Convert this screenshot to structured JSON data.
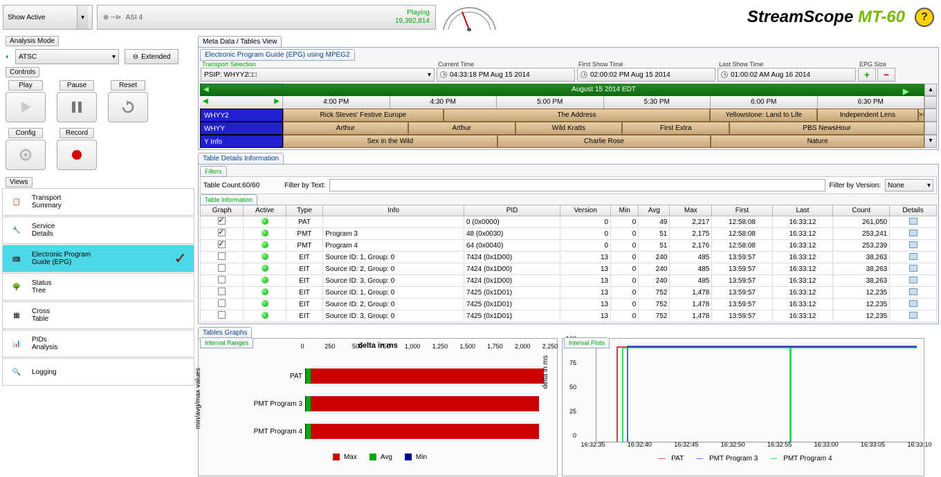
{
  "topbar": {
    "show_active": "Show Active",
    "stream_name": "ASI 4",
    "status": "Playing",
    "packets": "19,392,814"
  },
  "brand": {
    "name": "StreamScope",
    "model": " MT-60",
    "help": "?"
  },
  "analysis_mode": {
    "label": "Analysis Mode",
    "standard": "ATSC",
    "extended": "Extended"
  },
  "controls": {
    "label": "Controls",
    "play": "Play",
    "pause": "Pause",
    "reset": "Reset",
    "config": "Config",
    "record": "Record"
  },
  "views": {
    "label": "Views",
    "items": [
      {
        "line1": "Transport",
        "line2": "Summary"
      },
      {
        "line1": "Service",
        "line2": "Details"
      },
      {
        "line1": "Electronic Program",
        "line2": "Guide (EPG)"
      },
      {
        "line1": "Status",
        "line2": "Tree"
      },
      {
        "line1": "Cross",
        "line2": "Table"
      },
      {
        "line1": "PIDs",
        "line2": "Analysis"
      },
      {
        "line1": "Logging",
        "line2": ""
      }
    ]
  },
  "tabs": {
    "meta": "Meta Data / Tables View",
    "epg": "Electronic Program Guide (EPG) using MPEG2"
  },
  "epg_hdr": {
    "transport": "Transport Selection",
    "psip": "PSIP: WHYY2□□",
    "current_label": "Current Time",
    "current": "04:33:18 PM Aug 15 2014",
    "first_label": "First Show Time",
    "first": "02:00:02 PM Aug 15 2014",
    "last_label": "Last Show Time",
    "last": "01:00:02 AM Aug 16 2014",
    "size_label": "EPG Size"
  },
  "epg": {
    "date": "August 15 2014 EDT",
    "times": [
      "4:00 PM",
      "4:30 PM",
      "5:00 PM",
      "5:30 PM",
      "6:00 PM",
      "6:30 PM"
    ],
    "channels": [
      "WHYY2",
      "WHYY",
      "Y Info"
    ],
    "rows": [
      [
        {
          "t": "Rick Steves' Festive Europe",
          "w": 25
        },
        {
          "t": "The Address",
          "w": 41.6
        },
        {
          "t": "Yellowstone: Land to Life",
          "w": 16.7
        },
        {
          "t": "Independent Lens",
          "w": 15.7
        },
        {
          "t": ">>",
          "w": 1
        }
      ],
      [
        {
          "t": "Arthur",
          "w": 19.5
        },
        {
          "t": "Arthur",
          "w": 16.7
        },
        {
          "t": "Wild Kratts",
          "w": 16.7
        },
        {
          "t": "First Extra",
          "w": 16.7
        },
        {
          "t": "PBS NewsHour",
          "w": 30.4
        }
      ],
      [
        {
          "t": "Sex in the Wild",
          "w": 33.4
        },
        {
          "t": "Charlie Rose",
          "w": 33.3
        },
        {
          "t": "Nature",
          "w": 33.3
        }
      ]
    ]
  },
  "tdi": {
    "label": "Table Details Information",
    "filters": "Filters",
    "count": "Table Count:60/60",
    "filter_text": "Filter by Text:",
    "filter_ver": "Filter by Version:",
    "none": "None",
    "tinfo": "Table Information"
  },
  "table": {
    "headers": [
      "Graph",
      "Active",
      "Type",
      "Info",
      "PID",
      "Version",
      "Min",
      "Avg",
      "Max",
      "First",
      "Last",
      "Count",
      "Details"
    ],
    "rows": [
      {
        "g": true,
        "type": "PAT",
        "info": "",
        "pid": "0 (0x0000)",
        "ver": "0",
        "min": "0",
        "avg": "49",
        "max": "2,217",
        "first": "12:58:08",
        "last": "16:33:12",
        "count": "261,050"
      },
      {
        "g": true,
        "type": "PMT",
        "info": "Program 3",
        "pid": "48 (0x0030)",
        "ver": "0",
        "min": "0",
        "avg": "51",
        "max": "2,175",
        "first": "12:58:08",
        "last": "16:33:12",
        "count": "253,241"
      },
      {
        "g": true,
        "type": "PMT",
        "info": "Program 4",
        "pid": "64 (0x0040)",
        "ver": "0",
        "min": "0",
        "avg": "51",
        "max": "2,176",
        "first": "12:58:08",
        "last": "16:33:12",
        "count": "253,239"
      },
      {
        "g": false,
        "type": "EIT",
        "info": "Source ID: 1, Group: 0",
        "pid": "7424 (0x1D00)",
        "ver": "13",
        "min": "0",
        "avg": "240",
        "max": "485",
        "first": "13:59:57",
        "last": "16:33:12",
        "count": "38,263"
      },
      {
        "g": false,
        "type": "EIT",
        "info": "Source ID: 2, Group: 0",
        "pid": "7424 (0x1D00)",
        "ver": "13",
        "min": "0",
        "avg": "240",
        "max": "485",
        "first": "13:59:57",
        "last": "16:33:12",
        "count": "38,263"
      },
      {
        "g": false,
        "type": "EIT",
        "info": "Source ID: 3, Group: 0",
        "pid": "7424 (0x1D00)",
        "ver": "13",
        "min": "0",
        "avg": "240",
        "max": "485",
        "first": "13:59:57",
        "last": "16:33:12",
        "count": "38,263"
      },
      {
        "g": false,
        "type": "EIT",
        "info": "Source ID: 1, Group: 0",
        "pid": "7425 (0x1D01)",
        "ver": "13",
        "min": "0",
        "avg": "752",
        "max": "1,478",
        "first": "13:59:57",
        "last": "16:33:12",
        "count": "12,235"
      },
      {
        "g": false,
        "type": "EIT",
        "info": "Source ID: 2, Group: 0",
        "pid": "7425 (0x1D01)",
        "ver": "13",
        "min": "0",
        "avg": "752",
        "max": "1,478",
        "first": "13:59:57",
        "last": "16:33:12",
        "count": "12,235"
      },
      {
        "g": false,
        "type": "EIT",
        "info": "Source ID: 3, Group: 0",
        "pid": "7425 (0x1D01)",
        "ver": "13",
        "min": "0",
        "avg": "752",
        "max": "1,478",
        "first": "13:59:57",
        "last": "16:33:12",
        "count": "12,235"
      }
    ]
  },
  "graphs": {
    "label": "Tables Graphs",
    "ranges": "Interval Ranges",
    "plots": "Interval Plots"
  },
  "chart_data": [
    {
      "type": "bar",
      "orientation": "horizontal",
      "title": "delta in ms",
      "ylabel": "min/avg/max values",
      "xticks": [
        0,
        250,
        500,
        750,
        1000,
        1250,
        1500,
        1750,
        2000,
        2250
      ],
      "xlim": [
        0,
        2250
      ],
      "categories": [
        "PAT",
        "PMT Program 3",
        "PMT Program 4"
      ],
      "series": [
        {
          "name": "Max",
          "color": "#cc0000",
          "values": [
            2217,
            2175,
            2176
          ]
        },
        {
          "name": "Avg",
          "color": "#00aa00",
          "values": [
            49,
            51,
            51
          ]
        },
        {
          "name": "Min",
          "color": "#000088",
          "values": [
            0,
            0,
            0
          ]
        }
      ],
      "legend": [
        "Max",
        "Avg",
        "Min"
      ]
    },
    {
      "type": "line",
      "ylabel": "delta in ms",
      "ylim": [
        0,
        100
      ],
      "yticks": [
        0,
        25,
        50,
        75,
        100
      ],
      "xticks": [
        "16:32:35",
        "16:32:40",
        "16:32:45",
        "16:32:50",
        "16:32:55",
        "16:33:00",
        "16:33:05",
        "16:33:10"
      ],
      "series": [
        {
          "name": "PAT",
          "color": "#cc0000"
        },
        {
          "name": "PMT Program 3",
          "color": "#0040cc"
        },
        {
          "name": "PMT Program 4",
          "color": "#00cc33"
        }
      ],
      "legend": [
        "PAT",
        "PMT Program 3",
        "PMT Program 4"
      ]
    }
  ]
}
